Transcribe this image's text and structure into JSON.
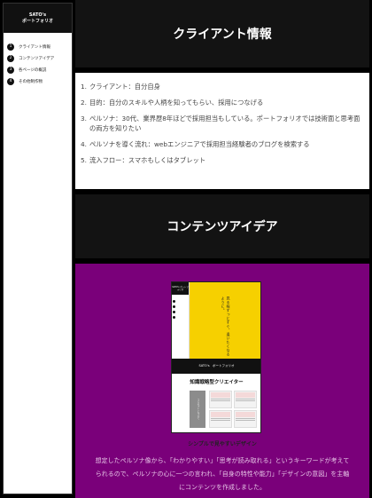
{
  "sidebar": {
    "title_line1": "SATO's",
    "title_line2": "ポートフォリオ",
    "items": [
      {
        "num": "1",
        "label": "クライアント情報"
      },
      {
        "num": "2",
        "label": "コンテンツアイデア"
      },
      {
        "num": "3",
        "label": "各ページの概説"
      },
      {
        "num": "4",
        "label": "その他制作物"
      }
    ]
  },
  "sections": {
    "client_title": "クライアント情報",
    "content_title": "コンテンツアイデア"
  },
  "client_info": [
    {
      "idx": "1.",
      "text": "クライアント：自分自身"
    },
    {
      "idx": "2.",
      "text": "目的：自分のスキルや人柄を知ってもらい、採用につなげる"
    },
    {
      "idx": "3.",
      "text": "ペルソナ：30代、業界歴8年ほどで採用担当もしている。ポートフォリオでは技術面と思考面の両方を知りたい"
    },
    {
      "idx": "4.",
      "text": "ペルソナを導く流れ：webエンジニアで採用担当経験者のブログを検索する"
    },
    {
      "idx": "5.",
      "text": "流入フロー：スマホもしくはタブレット"
    }
  ],
  "mockup": {
    "side_title": "SATO's ポートフォリオ",
    "nav": [
      "",
      "",
      "",
      ""
    ],
    "vertical_text": "見る程ずっとすぐ、逢いたくなるように。",
    "bar_text": "SATO's　ポートフォリオ",
    "heading": "知識戦略型クリエイター",
    "grey_text": "コンセプトについて"
  },
  "caption": "シンプルで見やすいデザイン",
  "body_text": "想定したペルソナ像から、「わかりやすい」「思考が読み取れる」というキーワードが考えてられるので、ペルソナの心に一つの言われ、「自身の特性や能力」「デザインの意図」を主軸にコンテンツを作成しました。",
  "colors": {
    "dark_band": "#131313",
    "purple": "#7a007a",
    "yellow": "#f6d000"
  }
}
